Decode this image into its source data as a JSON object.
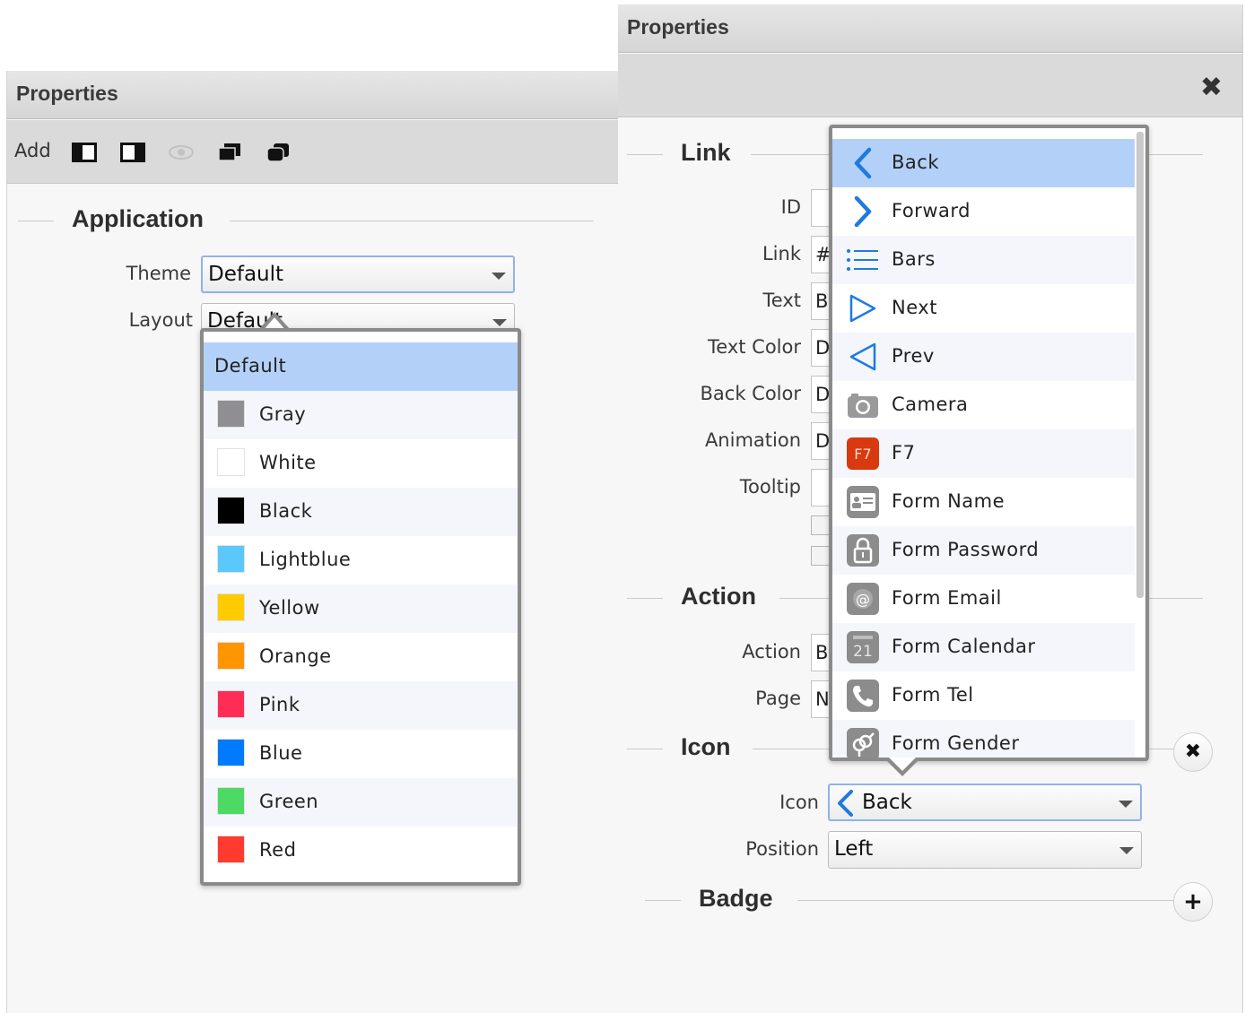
{
  "left_panel": {
    "title": "Properties",
    "toolbar": {
      "add_label": "Add"
    },
    "section_application": "Application",
    "theme_label": "Theme",
    "theme_value": "Default",
    "layout_label": "Layout",
    "layout_value": "Default",
    "theme_options": [
      {
        "label": "Default",
        "color": ""
      },
      {
        "label": "Gray",
        "color": "#8e8e93"
      },
      {
        "label": "White",
        "color": "#ffffff"
      },
      {
        "label": "Black",
        "color": "#000000"
      },
      {
        "label": "Lightblue",
        "color": "#5ac8fa"
      },
      {
        "label": "Yellow",
        "color": "#ffcc00"
      },
      {
        "label": "Orange",
        "color": "#ff9500"
      },
      {
        "label": "Pink",
        "color": "#ff2d55"
      },
      {
        "label": "Blue",
        "color": "#007aff"
      },
      {
        "label": "Green",
        "color": "#4cd964"
      },
      {
        "label": "Red",
        "color": "#ff3b30"
      }
    ]
  },
  "right_panel": {
    "title": "Properties",
    "close_symbol": "✖",
    "section_link": "Link",
    "fields": [
      {
        "label": "ID",
        "stub": ""
      },
      {
        "label": "Link",
        "stub": "#"
      },
      {
        "label": "Text",
        "stub": "B"
      },
      {
        "label": "Text Color",
        "stub": "D"
      },
      {
        "label": "Back Color",
        "stub": "D"
      },
      {
        "label": "Animation",
        "stub": "D"
      },
      {
        "label": "Tooltip",
        "stub": ""
      }
    ],
    "section_action": "Action",
    "action_fields": [
      {
        "label": "Action",
        "stub": "B"
      },
      {
        "label": "Page",
        "stub": "N"
      }
    ],
    "section_icon": "Icon",
    "icon_remove_symbol": "✖",
    "icon_label": "Icon",
    "icon_value": "Back",
    "position_label": "Position",
    "position_value": "Left",
    "section_badge": "Badge",
    "badge_add_symbol": "+",
    "icon_options": [
      {
        "label": "Back",
        "icon": "chevron-left-icon"
      },
      {
        "label": "Forward",
        "icon": "chevron-right-icon"
      },
      {
        "label": "Bars",
        "icon": "bars-icon"
      },
      {
        "label": "Next",
        "icon": "triangle-right-icon"
      },
      {
        "label": "Prev",
        "icon": "triangle-left-icon"
      },
      {
        "label": "Camera",
        "icon": "camera-icon"
      },
      {
        "label": "F7",
        "icon": "f7-logo-icon",
        "icon_text": "F7"
      },
      {
        "label": "Form Name",
        "icon": "form-name-icon"
      },
      {
        "label": "Form Password",
        "icon": "form-password-icon"
      },
      {
        "label": "Form Email",
        "icon": "form-email-icon",
        "icon_text": "@"
      },
      {
        "label": "Form Calendar",
        "icon": "form-calendar-icon",
        "icon_text": "21"
      },
      {
        "label": "Form Tel",
        "icon": "form-tel-icon"
      },
      {
        "label": "Form Gender",
        "icon": "form-gender-icon"
      }
    ]
  },
  "colors": {
    "selected_row": "#b3d1f8",
    "accent_blue": "#1f7ae0",
    "f7_red": "#d9390f",
    "form_icon_gray": "#8c8c8c"
  }
}
